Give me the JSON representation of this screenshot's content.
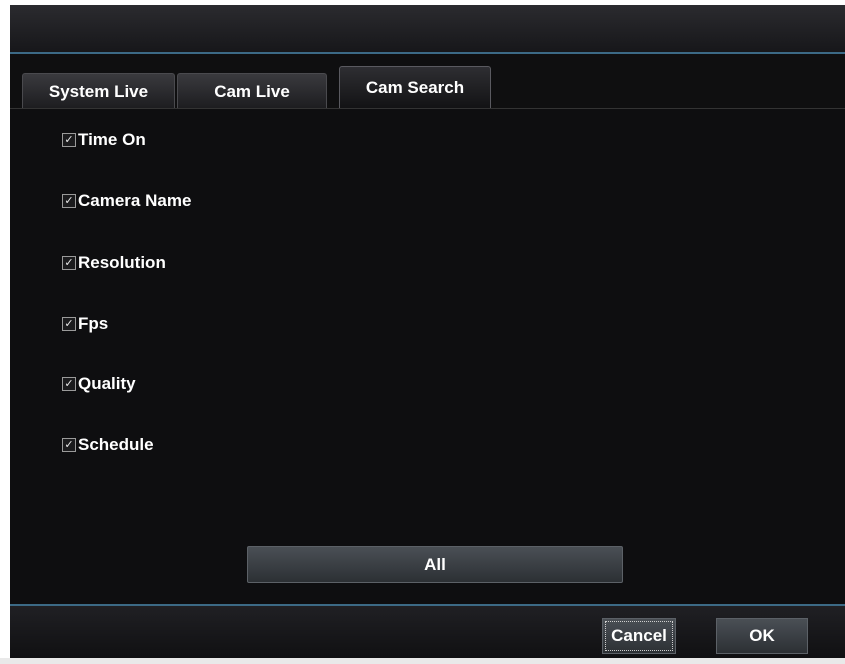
{
  "tabs": [
    {
      "label": "System Live",
      "active": false
    },
    {
      "label": "Cam Live",
      "active": false
    },
    {
      "label": "Cam Search",
      "active": true
    }
  ],
  "options": [
    {
      "label": "Time On",
      "checked": true
    },
    {
      "label": "Camera Name",
      "checked": true
    },
    {
      "label": "Resolution",
      "checked": true
    },
    {
      "label": "Fps",
      "checked": true
    },
    {
      "label": "Quality",
      "checked": true
    },
    {
      "label": "Schedule",
      "checked": true
    }
  ],
  "all_button": "All",
  "footer": {
    "cancel_label": "Cancel",
    "ok_label": "OK"
  },
  "colors": {
    "accent_line": "#3c6a86",
    "background": "#0e0e10",
    "text": "#ffffff"
  }
}
